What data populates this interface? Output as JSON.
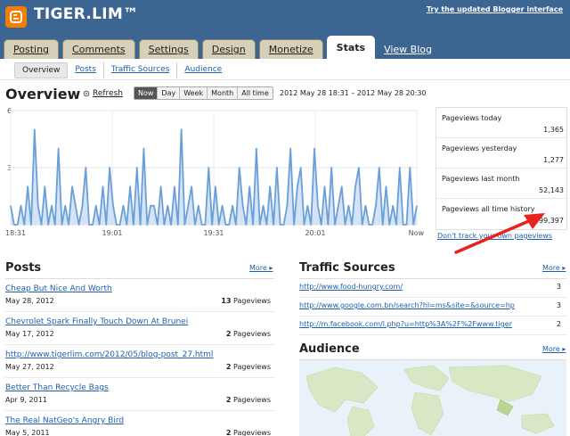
{
  "header": {
    "blog_title": "TIGER.LIM™",
    "try_link": "Try the updated Blogger interface",
    "colors": {
      "bar": "#3d6592",
      "logo": "#f57d00"
    }
  },
  "tabs": [
    {
      "label": "Posting",
      "active": false
    },
    {
      "label": "Comments",
      "active": false
    },
    {
      "label": "Settings",
      "active": false
    },
    {
      "label": "Design",
      "active": false
    },
    {
      "label": "Monetize",
      "active": false
    },
    {
      "label": "Stats",
      "active": true
    }
  ],
  "view_blog": "View Blog",
  "subnav": [
    {
      "label": "Overview",
      "active": true
    },
    {
      "label": "Posts",
      "active": false
    },
    {
      "label": "Traffic Sources",
      "active": false
    },
    {
      "label": "Audience",
      "active": false
    }
  ],
  "overview": {
    "title": "Overview",
    "refresh": "Refresh",
    "ranges": [
      "Now",
      "Day",
      "Week",
      "Month",
      "All time"
    ],
    "active_range": "Now",
    "date_range": "2012 May 28 18:31 – 2012 May 28 20:30"
  },
  "chart_data": {
    "type": "area",
    "y_ticks": [
      "6",
      "3"
    ],
    "ylim": [
      0,
      6
    ],
    "x_ticks": [
      "18:31",
      "19:01",
      "19:31",
      "20:01",
      "Now"
    ],
    "grid": true,
    "color": "#6a9fd8",
    "values": [
      1,
      0,
      0,
      1,
      0,
      2,
      0,
      5,
      1,
      0,
      2,
      0,
      1,
      0,
      4,
      0,
      1,
      0,
      2,
      1,
      0,
      1,
      3,
      0,
      0,
      1,
      0,
      2,
      0,
      3,
      1,
      0,
      0,
      1,
      0,
      2,
      0,
      3,
      0,
      4,
      0,
      1,
      1,
      0,
      2,
      0,
      1,
      0,
      2,
      0,
      5,
      0,
      1,
      2,
      0,
      1,
      0,
      0,
      3,
      0,
      2,
      0,
      1,
      0,
      0,
      1,
      0,
      3,
      1,
      0,
      2,
      0,
      4,
      0,
      1,
      0,
      2,
      0,
      3,
      0,
      0,
      1,
      4,
      0,
      2,
      3,
      0,
      1,
      0,
      4,
      1,
      0,
      2,
      0,
      3,
      0,
      1,
      2,
      0,
      1,
      0,
      2,
      3,
      0,
      1,
      0,
      0,
      1,
      3,
      0,
      2,
      0,
      1,
      0,
      3,
      0,
      0,
      3,
      0,
      1
    ]
  },
  "stats": [
    {
      "label": "Pageviews today",
      "value": "1,365"
    },
    {
      "label": "Pageviews yesterday",
      "value": "1,277"
    },
    {
      "label": "Pageviews last month",
      "value": "52,143"
    },
    {
      "label": "Pageviews all time history",
      "value": "999,397"
    }
  ],
  "dont_track": "Don't track your own pageviews",
  "posts": {
    "title": "Posts",
    "more": "More",
    "items": [
      {
        "title": "Cheap But Nice And Worth",
        "date": "May 28, 2012",
        "count": "13",
        "unit": "Pageviews"
      },
      {
        "title": "Chevrolet Spark Finally Touch Down At Brunei",
        "date": "May 17, 2012",
        "count": "2",
        "unit": "Pageviews"
      },
      {
        "title": "http://www.tigerlim.com/2012/05/blog-post_27.html",
        "date": "May 27, 2012",
        "count": "2",
        "unit": "Pageviews"
      },
      {
        "title": "Better Than Recycle Bags",
        "date": "Apr 9, 2011",
        "count": "2",
        "unit": "Pageviews"
      },
      {
        "title": "The Real NatGeo's Angry Bird",
        "date": "May 5, 2011",
        "count": "2",
        "unit": "Pageviews"
      }
    ]
  },
  "traffic": {
    "title": "Traffic Sources",
    "more": "More",
    "items": [
      {
        "url": "http://www.food-hungry.com/",
        "count": "3"
      },
      {
        "url": "http://www.google.com.bn/search?hl=ms&site=&source=hp",
        "count": "3"
      },
      {
        "url": "http://m.facebook.com/l.php?u=http%3A%2F%2Fwww.tiger",
        "count": "2"
      }
    ]
  },
  "audience": {
    "title": "Audience",
    "more": "More"
  }
}
